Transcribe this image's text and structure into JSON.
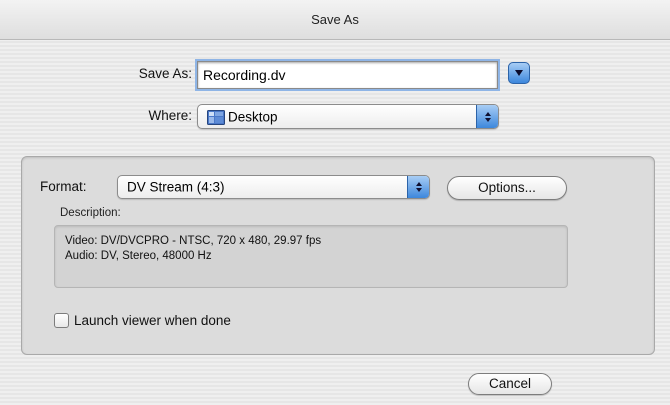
{
  "window": {
    "title": "Save As"
  },
  "save_as": {
    "label": "Save As:",
    "value": "Recording.dv"
  },
  "where": {
    "label": "Where:",
    "value": "Desktop"
  },
  "format": {
    "label": "Format:",
    "value": "DV Stream (4:3)",
    "options_button": "Options..."
  },
  "description": {
    "label": "Description:",
    "lines": [
      "Video: DV/DVCPRO - NTSC, 720 x 480, 29.97 fps",
      "Audio: DV, Stereo, 48000 Hz"
    ]
  },
  "launch_viewer": {
    "label": "Launch viewer when done",
    "checked": false
  },
  "buttons": {
    "cancel": "Cancel"
  },
  "colors": {
    "accent": "#3d87dc",
    "focus_ring": "#8fb5e6"
  },
  "icons": {
    "where_folder": "desktop-folder-icon",
    "disclosure": "disclosure-triangle-icon"
  }
}
